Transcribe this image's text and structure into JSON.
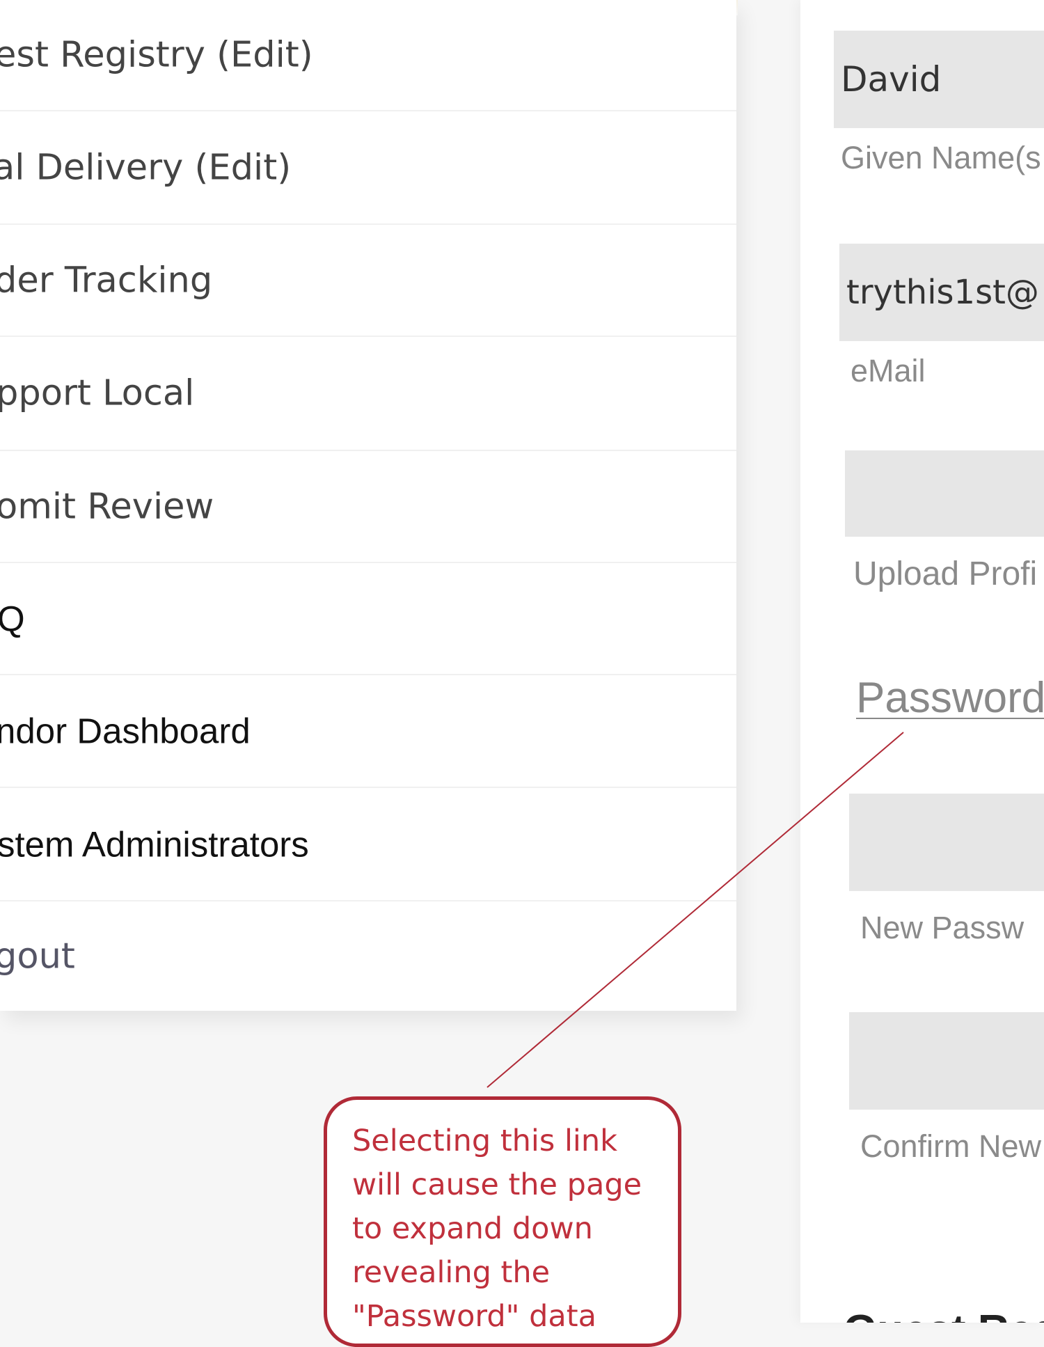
{
  "menu": {
    "items": [
      {
        "label": "est Registry (Edit)"
      },
      {
        "label": "al Delivery (Edit)"
      },
      {
        "label": "der Tracking"
      },
      {
        "label": "pport Local"
      },
      {
        "label": "omit Review"
      },
      {
        "label": "Q"
      },
      {
        "label": "ndor Dashboard"
      },
      {
        "label": "stem Administrators"
      },
      {
        "label": "gout"
      }
    ]
  },
  "profile_form": {
    "given_name": {
      "value": "David",
      "label": "Given Name(s"
    },
    "email": {
      "value": "trythis1st@",
      "label": "eMail"
    },
    "upload": {
      "value": "",
      "label": "Upload Profi"
    },
    "password_link": "Password",
    "new_password": {
      "value": "",
      "label": "New Passw"
    },
    "confirm_password": {
      "value": "",
      "label": "Confirm New"
    },
    "next_section_heading": "Guest Reg"
  },
  "annotation": {
    "text": "Selecting this link\nwill cause the page\nto expand down\nrevealing the\n\"Password\" data"
  },
  "colors": {
    "annotation": "#c0303c",
    "field_background": "#e6e6e6",
    "label": "#8a8a8a"
  }
}
